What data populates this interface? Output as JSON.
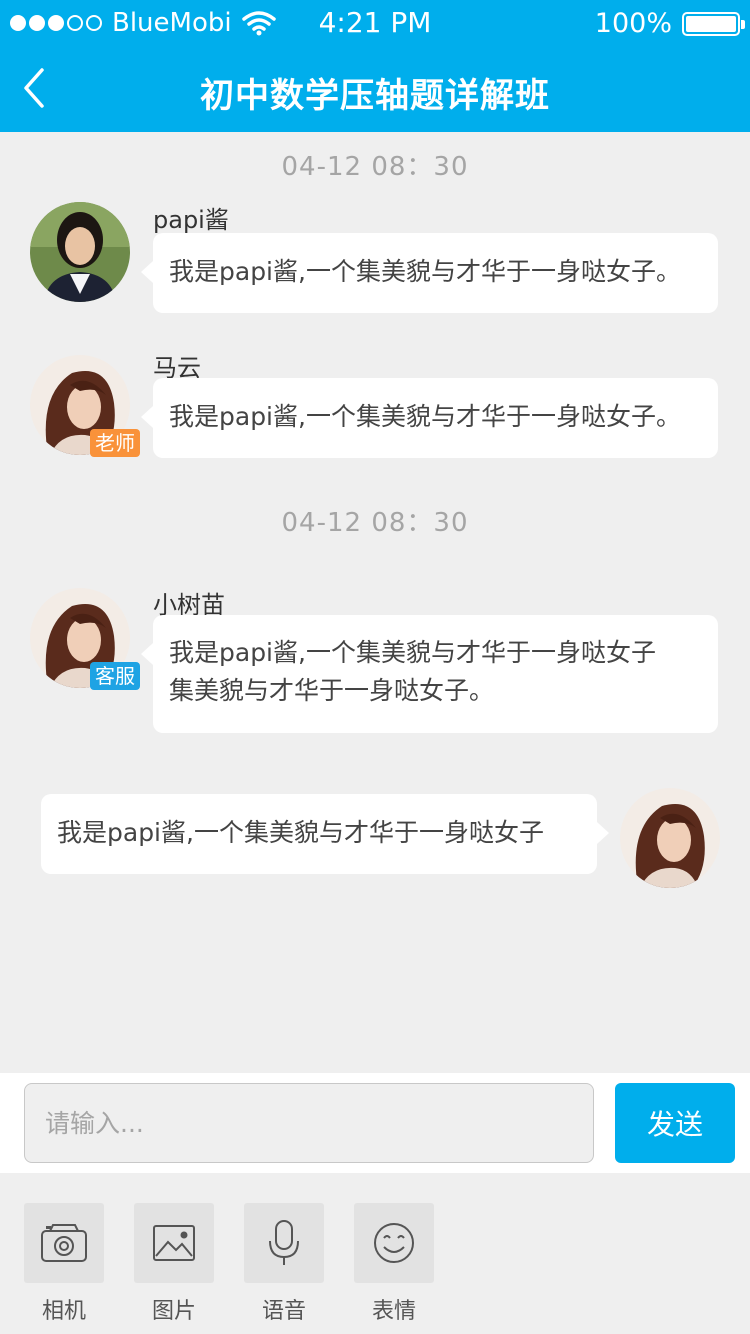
{
  "status_bar": {
    "carrier": "BlueMobi",
    "time": "4:21 PM",
    "battery": "100%"
  },
  "nav": {
    "title": "初中数学压轴题详解班"
  },
  "chat": {
    "timestamps": [
      "04-12   08：30",
      "04-12   08：30"
    ],
    "messages": [
      {
        "sender": "papi酱",
        "text": "我是papi酱,一个集美貌与才华于一身哒女子。",
        "badge": ""
      },
      {
        "sender": "马云",
        "text": "我是papi酱,一个集美貌与才华于一身哒女子。",
        "badge": "老师"
      },
      {
        "sender": "小树苗",
        "text_line1": "我是papi酱,一个集美貌与才华于一身哒女子",
        "text_line2": "集美貌与才华于一身哒女子。",
        "badge": "客服"
      },
      {
        "sender": "",
        "text": "我是papi酱,一个集美貌与才华于一身哒女子",
        "badge": ""
      }
    ]
  },
  "input": {
    "placeholder": "请输入...",
    "send_label": "发送"
  },
  "toolbar": {
    "items": [
      {
        "label": "相机",
        "icon": "camera-icon"
      },
      {
        "label": "图片",
        "icon": "image-icon"
      },
      {
        "label": "语音",
        "icon": "microphone-icon"
      },
      {
        "label": "表情",
        "icon": "emoji-icon"
      }
    ]
  },
  "colors": {
    "primary": "#00aeec",
    "teacher_badge": "#f9923a",
    "service_badge": "#1ea3e4",
    "background": "#efefef"
  }
}
